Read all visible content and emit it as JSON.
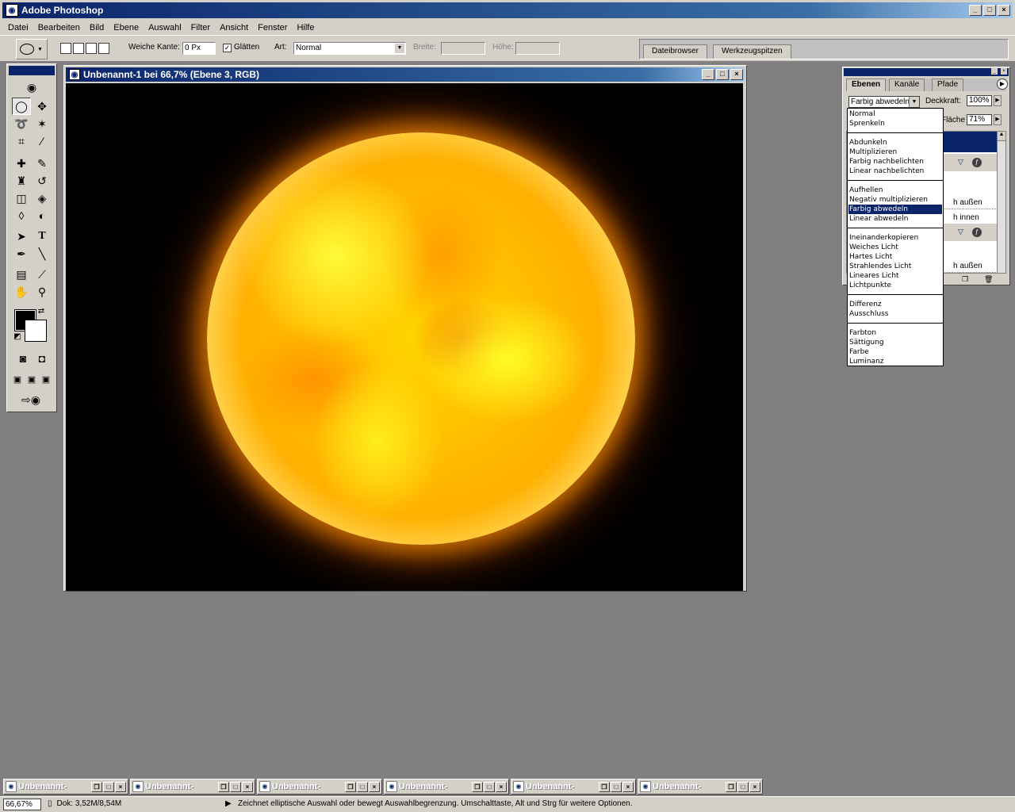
{
  "app": {
    "title": "Adobe Photoshop"
  },
  "menu": [
    "Datei",
    "Bearbeiten",
    "Bild",
    "Ebene",
    "Auswahl",
    "Filter",
    "Ansicht",
    "Fenster",
    "Hilfe"
  ],
  "options": {
    "feather_label": "Weiche Kante:",
    "feather_value": "0 Px",
    "antialias_label": "Glätten",
    "antialias_checked": "✓",
    "style_label": "Art:",
    "style_value": "Normal",
    "width_label": "Breite:",
    "height_label": "Höhe:"
  },
  "palette_well": {
    "tabs": [
      "Dateibrowser",
      "Werkzeugspitzen"
    ]
  },
  "document": {
    "title": "Unbenannt-1 bei 66,7% (Ebene 3, RGB)"
  },
  "layers_panel": {
    "tabs": [
      "Ebenen",
      "Kanäle",
      "Pfade"
    ],
    "blend_mode": "Farbig abwedeln",
    "opacity_label": "Deckkraft:",
    "opacity_value": "100%",
    "fill_label": "Fläche",
    "fill_value": "71%",
    "rows": [
      "h außen",
      "h innen",
      "h außen"
    ]
  },
  "blend_dropdown": {
    "items": [
      "Normal",
      "Sprenkeln",
      "Abdunkeln",
      "Multiplizieren",
      "Farbig nachbelichten",
      "Linear nachbelichten",
      "Aufhellen",
      "Negativ multiplizieren",
      "Farbig abwedeln",
      "Linear abwedeln",
      "Ineinanderkopieren",
      "Weiches Licht",
      "Hartes Licht",
      "Strahlendes Licht",
      "Lineares Licht",
      "Lichtpunkte",
      "Differenz",
      "Ausschluss",
      "Farbton",
      "Sättigung",
      "Farbe",
      "Luminanz"
    ],
    "selected": "Farbig abwedeln"
  },
  "minimized_docs": [
    "Unbenannt-",
    "Unbenannt-",
    "Unbenannt-",
    "Unbenannt-",
    "Unbenannt-",
    "Unbenannt-"
  ],
  "status": {
    "zoom": "66,67%",
    "doc_size": "Dok: 3,52M/8,54M",
    "message": "Zeichnet elliptische Auswahl oder bewegt Auswahlbegrenzung. Umschalttaste, Alt und Strg für weitere Optionen."
  },
  "colors": {
    "titlebar": "#0a246a",
    "chrome": "#d4d0c8",
    "workspace": "#808080",
    "foreground": "#000000",
    "background": "#ffffff"
  },
  "icons": [
    "ellipse-marquee-icon",
    "move-icon",
    "lasso-icon",
    "magic-wand-icon",
    "crop-icon",
    "slice-icon",
    "healing-brush-icon",
    "brush-icon",
    "stamp-icon",
    "history-brush-icon",
    "eraser-icon",
    "paint-bucket-icon",
    "blur-icon",
    "dodge-icon",
    "path-select-icon",
    "type-icon",
    "pen-icon",
    "line-icon",
    "notes-icon",
    "eyedropper-icon",
    "hand-icon",
    "zoom-icon"
  ]
}
